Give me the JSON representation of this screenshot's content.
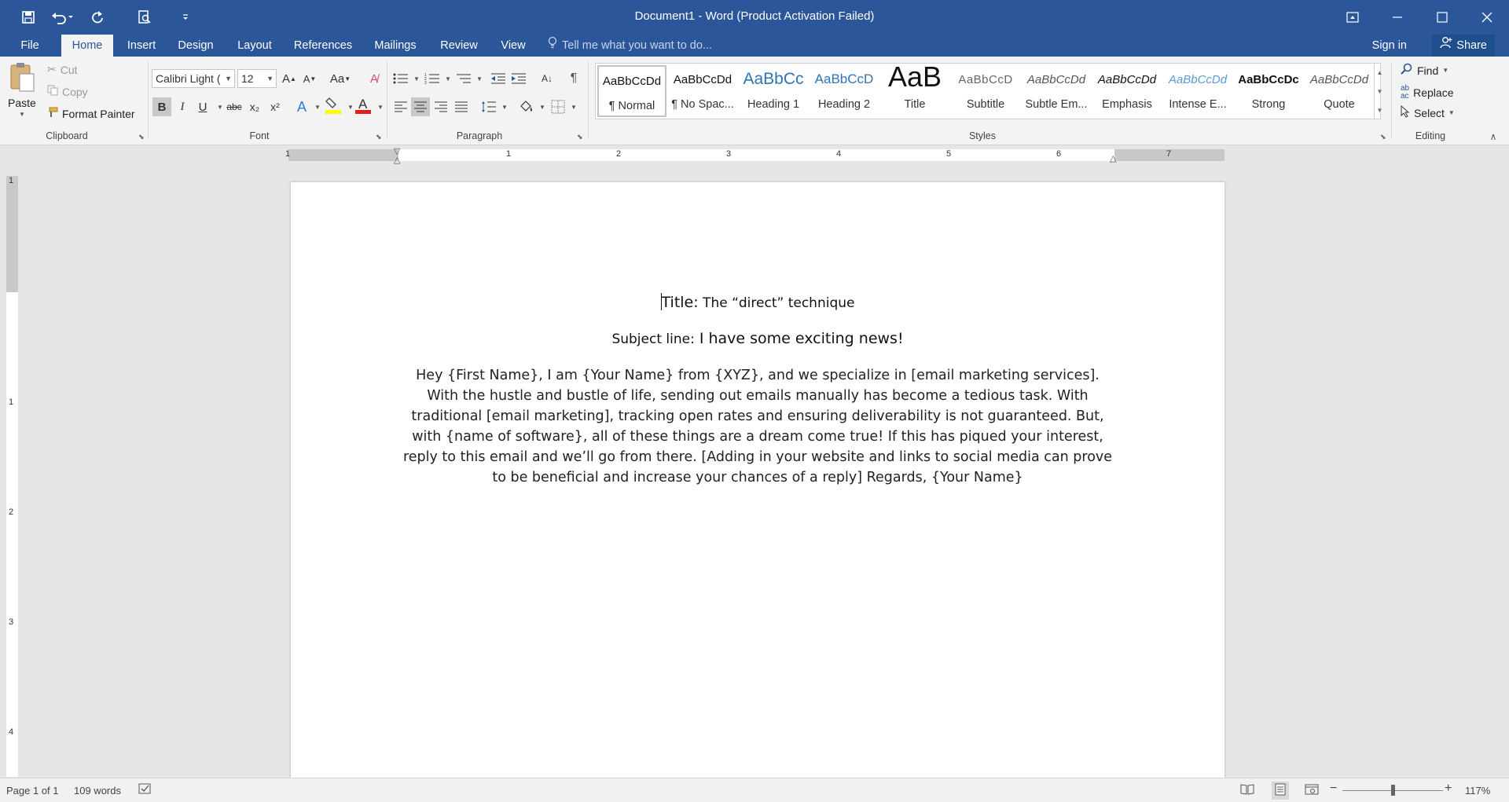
{
  "window": {
    "title": "Document1 - Word (Product Activation Failed)"
  },
  "quick_access": {
    "save_icon": "save-icon",
    "undo_icon": "undo-icon",
    "redo_icon": "redo-icon",
    "print_preview_icon": "print-preview-icon",
    "customize_icon": "customize-qat-icon"
  },
  "tabs": [
    {
      "label": "File"
    },
    {
      "label": "Home"
    },
    {
      "label": "Insert"
    },
    {
      "label": "Design"
    },
    {
      "label": "Layout"
    },
    {
      "label": "References"
    },
    {
      "label": "Mailings"
    },
    {
      "label": "Review"
    },
    {
      "label": "View"
    }
  ],
  "tell_me": {
    "placeholder": "Tell me what you want to do..."
  },
  "account": {
    "signin": "Sign in",
    "share": "Share"
  },
  "clipboard": {
    "paste": "Paste",
    "cut": "Cut",
    "copy": "Copy",
    "format_painter": "Format Painter",
    "label": "Clipboard"
  },
  "font": {
    "family": "Calibri Light (",
    "size": "12",
    "case_label": "Aa",
    "label": "Font",
    "bold": "B",
    "italic": "I",
    "underline": "U",
    "strike": "abc",
    "subscript": "x₂",
    "superscript": "x²",
    "font_color": "#e02020",
    "highlight_color": "#ffff00"
  },
  "paragraph": {
    "label": "Paragraph",
    "pilcrow": "¶"
  },
  "styles": {
    "label": "Styles",
    "items": [
      {
        "sample": "AaBbCcDd",
        "name": "¶ Normal"
      },
      {
        "sample": "AaBbCcDd",
        "name": "¶ No Spac..."
      },
      {
        "sample": "AaBbCc",
        "name": "Heading 1"
      },
      {
        "sample": "AaBbCcD",
        "name": "Heading 2"
      },
      {
        "sample": "AaB",
        "name": "Title"
      },
      {
        "sample": "AaBbCcD",
        "name": "Subtitle"
      },
      {
        "sample": "AaBbCcDd",
        "name": "Subtle Em..."
      },
      {
        "sample": "AaBbCcDd",
        "name": "Emphasis"
      },
      {
        "sample": "AaBbCcDd",
        "name": "Intense E..."
      },
      {
        "sample": "AaBbCcDc",
        "name": "Strong"
      },
      {
        "sample": "AaBbCcDd",
        "name": "Quote"
      }
    ]
  },
  "editing": {
    "find": "Find",
    "replace": "Replace",
    "select": "Select",
    "label": "Editing"
  },
  "ruler": {
    "h_numbers": [
      "1",
      "1",
      "2",
      "3",
      "4",
      "5",
      "6",
      "7"
    ],
    "v_numbers": [
      "1",
      "1",
      "2",
      "3",
      "4"
    ]
  },
  "document": {
    "title_prefix": "Title:",
    "title_text": " The “direct” technique",
    "subject_prefix": "Subject line:",
    "subject_text": " I have some exciting news!",
    "body": "Hey {First Name}, I am {Your Name} from {XYZ}, and we specialize in [email marketing services]. With the hustle and bustle of life, sending out emails manually has become a tedious task. With traditional [email marketing], tracking open rates and ensuring deliverability is not guaranteed. But, with {name of software}, all of these things are a dream come true! If this has piqued your interest, reply to this email and we’ll go from there. [Adding in your website and links to social media can prove to be beneficial and increase your chances of a reply] Regards, {Your Name}"
  },
  "status": {
    "page": "Page 1 of 1",
    "words": "109 words",
    "zoom": "117%",
    "zoom_minus": "−",
    "zoom_plus": "+"
  },
  "colors": {
    "accent": "#2b579a"
  }
}
